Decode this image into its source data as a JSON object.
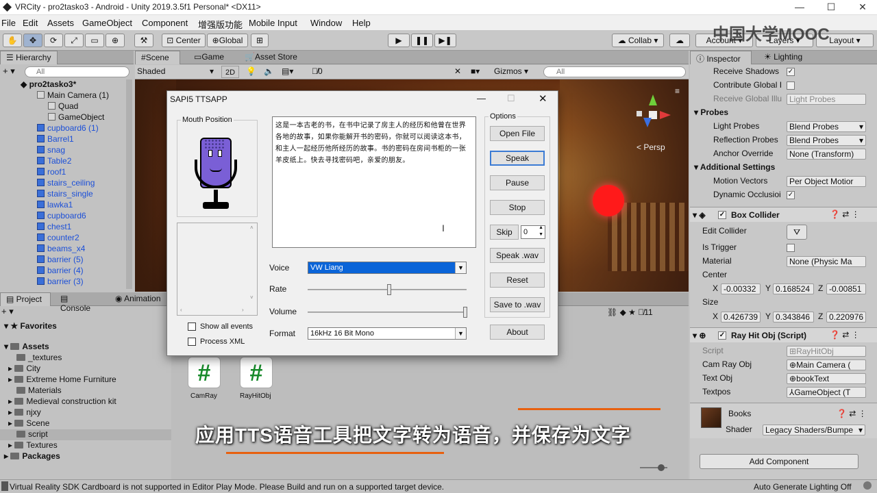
{
  "window": {
    "title": "VRCity - pro2tasko3 - Android - Unity 2019.3.5f1 Personal* <DX11>"
  },
  "menu": [
    "File",
    "Edit",
    "Assets",
    "GameObject",
    "Component",
    "增强版功能",
    "Mobile Input",
    "Window",
    "Help"
  ],
  "toolbar": {
    "center": "Center",
    "global": "Global",
    "collab": "Collab",
    "account": "Account",
    "layers": "Layers",
    "layout": "Layout"
  },
  "watermark": "中国大学MOOC",
  "hierarchy": {
    "tab": "Hierarchy",
    "search_placeholder": "All",
    "items": [
      {
        "label": "pro2tasko3*",
        "blue": false
      },
      {
        "label": "Main Camera (1)",
        "blue": false
      },
      {
        "label": "Quad",
        "blue": false
      },
      {
        "label": "GameObject",
        "blue": false
      },
      {
        "label": "cupboard6 (1)",
        "blue": true
      },
      {
        "label": "Barrel1",
        "blue": true
      },
      {
        "label": "snag",
        "blue": true
      },
      {
        "label": "Table2",
        "blue": true
      },
      {
        "label": "roof1",
        "blue": true
      },
      {
        "label": "stairs_ceiling",
        "blue": true
      },
      {
        "label": "stairs_single",
        "blue": true
      },
      {
        "label": "lawka1",
        "blue": true
      },
      {
        "label": "cupboard6",
        "blue": true
      },
      {
        "label": "chest1",
        "blue": true
      },
      {
        "label": "counter2",
        "blue": true
      },
      {
        "label": "beams_x4",
        "blue": true
      },
      {
        "label": "barrier (5)",
        "blue": true
      },
      {
        "label": "barrier (4)",
        "blue": true
      },
      {
        "label": "barrier (3)",
        "blue": true
      }
    ]
  },
  "scene": {
    "tabs": [
      "Scene",
      "Game",
      "Asset Store"
    ],
    "shading": "Shaded",
    "mode": "2D",
    "gizmos": "Gizmos",
    "search_placeholder": "All",
    "persp": "< Persp",
    "hidden_count": "0"
  },
  "dialog": {
    "title": "SAPI5 TTSAPP",
    "mouth_label": "Mouth Position",
    "text": "这是一本古老的书，在书中记录了房主人的经历和他曾在世界各地的故事，如果你能解开书的密码，你就可以阅读这本书，和主人一起经历他所经历的故事。书的密码在房间书柜的一张羊皮纸上。快去寻找密码吧，亲爱的朋友。",
    "options_label": "Options",
    "buttons": [
      "Open File",
      "Speak",
      "Pause",
      "Stop",
      "Skip",
      "Speak .wav",
      "Reset",
      "Save to .wav",
      "About"
    ],
    "skip_value": "0",
    "voice_label": "Voice",
    "voice_value": "VW Liang",
    "rate_label": "Rate",
    "volume_label": "Volume",
    "format_label": "Format",
    "format_value": "16kHz 16 Bit Mono",
    "show_all_events": "Show all events",
    "process_xml": "Process XML"
  },
  "project": {
    "tabs": [
      "Project",
      "Console",
      "Animation"
    ],
    "favorites": "Favorites",
    "assets": "Assets",
    "packages": "Packages",
    "folders": [
      "_textures",
      "City",
      "Extreme Home Furniture",
      "Materials",
      "Medieval construction kit",
      "njxy",
      "Scene",
      "script",
      "Textures"
    ],
    "files": [
      "CamRay",
      "RayHitObj"
    ],
    "hidden_count": "11"
  },
  "inspector": {
    "tabs": [
      "Inspector",
      "Lighting"
    ],
    "rows": {
      "receive_shadows": "Receive Shadows",
      "contribute_gi": "Contribute Global I",
      "receive_gi": "Receive Global Illu",
      "receive_gi_value": "Light Probes",
      "probes": "Probes",
      "light_probes": "Light Probes",
      "light_probes_value": "Blend Probes",
      "reflection_probes": "Reflection Probes",
      "reflection_probes_value": "Blend Probes",
      "anchor_override": "Anchor Override",
      "anchor_override_value": "None (Transform)",
      "additional_settings": "Additional Settings",
      "motion_vectors": "Motion Vectors",
      "motion_vectors_value": "Per Object Motior",
      "dynamic_occlusion": "Dynamic Occlusioi"
    },
    "box_collider": {
      "title": "Box Collider",
      "edit_collider": "Edit Collider",
      "is_trigger": "Is Trigger",
      "material": "Material",
      "material_value": "None (Physic Ma",
      "center": "Center",
      "center_x": "-0.00332",
      "center_y": "0.168524",
      "center_z": "-0.00851",
      "size": "Size",
      "size_x": "0.426739",
      "size_y": "0.343846",
      "size_z": "0.220976"
    },
    "script": {
      "title": "Ray Hit Obj (Script)",
      "script_label": "Script",
      "script_value": "RayHitObj",
      "cam_ray_obj": "Cam Ray Obj",
      "cam_ray_obj_value": "Main Camera (",
      "text_obj": "Text Obj",
      "text_obj_value": "bookText",
      "textpos": "Textpos",
      "textpos_value": "GameObject (T"
    },
    "material": {
      "name": "Books",
      "shader_label": "Shader",
      "shader_value": "Legacy Shaders/Bumpe"
    },
    "add_component": "Add Component",
    "auto_generate": "Auto Generate Lighting Off"
  },
  "subtitle": "应用TTS语音工具把文字转为语音，并保存为文字",
  "status": "Virtual Reality SDK Cardboard is not supported in Editor Play Mode. Please Build and run on a supported target device.",
  "colors": {
    "accent": "#3b7bd4",
    "asset_blue": "#1b4fd8",
    "red_ball": "#ff1a1a",
    "script_green": "#178a2a"
  }
}
